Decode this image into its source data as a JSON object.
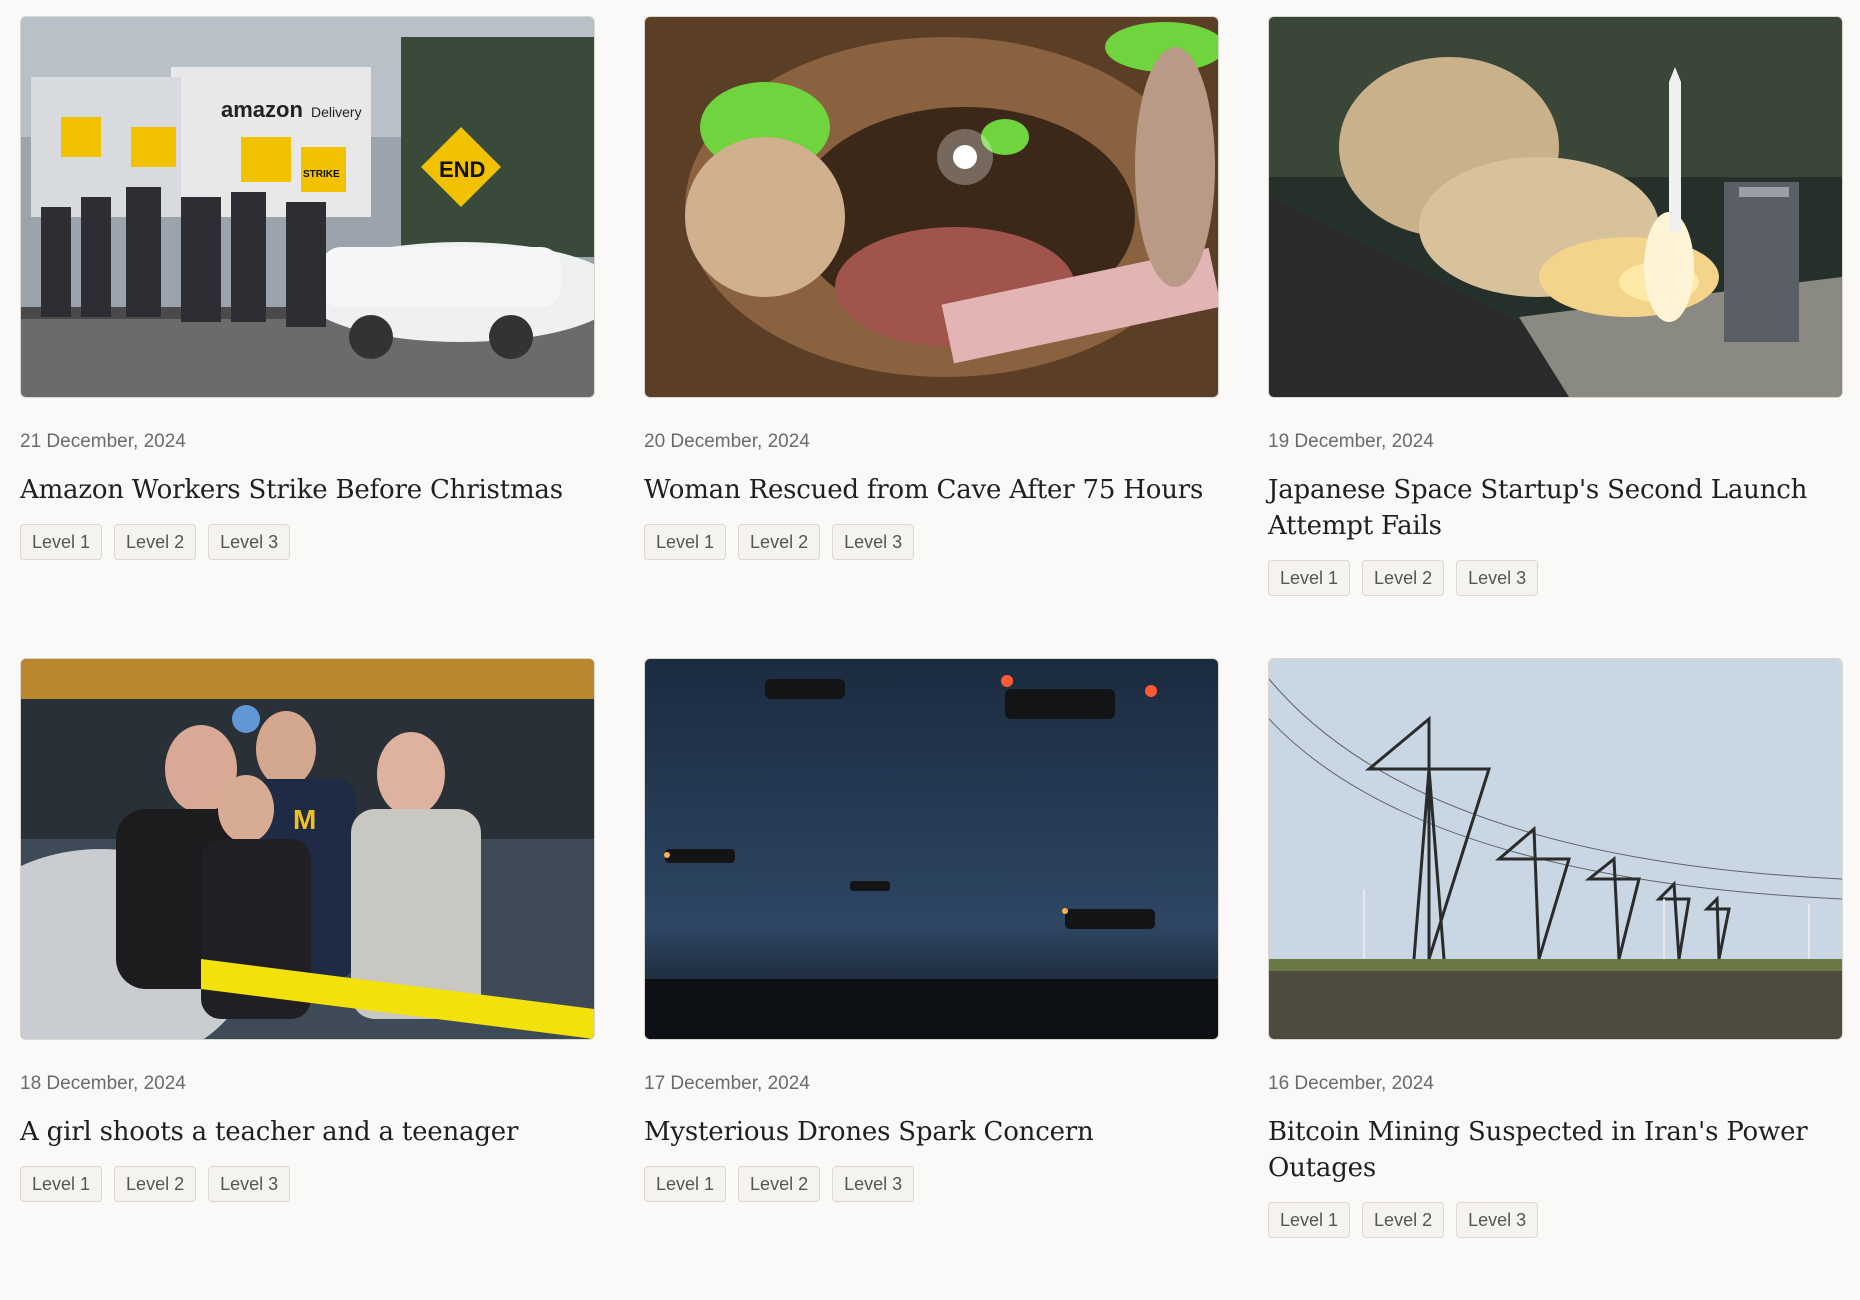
{
  "articles": [
    {
      "date": "21 December, 2024",
      "title": "Amazon Workers Strike Before Christmas",
      "levels": [
        "Level 1",
        "Level 2",
        "Level 3"
      ],
      "image_alt": "Workers with strike signs outside an Amazon Delivery facility"
    },
    {
      "date": "20 December, 2024",
      "title": "Woman Rescued from Cave After 75 Hours",
      "levels": [
        "Level 1",
        "Level 2",
        "Level 3"
      ],
      "image_alt": "Rescuers in green helmets inside a cave"
    },
    {
      "date": "19 December, 2024",
      "title": "Japanese Space Startup's Second Launch Attempt Fails",
      "levels": [
        "Level 1",
        "Level 2",
        "Level 3"
      ],
      "image_alt": "Rocket launching with large smoke plume"
    },
    {
      "date": "18 December, 2024",
      "title": "A girl shoots a teacher and a teenager",
      "levels": [
        "Level 1",
        "Level 2",
        "Level 3"
      ],
      "image_alt": "Woman and girls walking past police tape"
    },
    {
      "date": "17 December, 2024",
      "title": "Mysterious Drones Spark Concern",
      "levels": [
        "Level 1",
        "Level 2",
        "Level 3"
      ],
      "image_alt": "Several drones flying in the night sky"
    },
    {
      "date": "16 December, 2024",
      "title": "Bitcoin Mining Suspected in Iran's Power Outages",
      "levels": [
        "Level 1",
        "Level 2",
        "Level 3"
      ],
      "image_alt": "Electricity transmission towers across a field"
    }
  ],
  "image_texts": {
    "amazon_sign": "amazon",
    "amazon_sign_sub": "Delivery",
    "end_sign": "END",
    "strike_sign": "STRIKE"
  }
}
